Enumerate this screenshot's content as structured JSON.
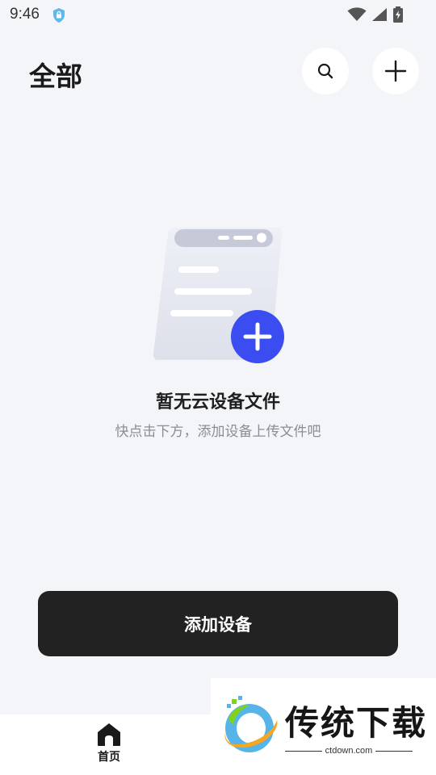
{
  "status_bar": {
    "time": "9:46"
  },
  "header": {
    "title": "全部",
    "search_icon": "search-icon",
    "add_icon": "plus-icon"
  },
  "empty_state": {
    "title": "暂无云设备文件",
    "subtitle": "快点击下方，添加设备上传文件吧",
    "accent_color": "#3b4cf0"
  },
  "primary_action": {
    "label": "添加设备"
  },
  "bottom_nav": {
    "items": [
      {
        "label": "首页",
        "icon": "home-icon"
      }
    ]
  },
  "watermark": {
    "brand": "传统下载",
    "domain": "ctdown.com"
  }
}
